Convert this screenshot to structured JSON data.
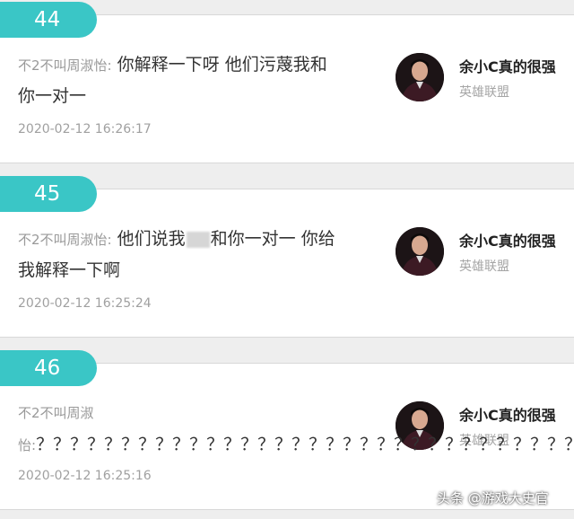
{
  "comments": [
    {
      "number": "44",
      "sender": "不2不叫周淑怡:",
      "text_line1": "你解释一下呀 他们污蔑我和",
      "text_line2": "你一对一",
      "timestamp": "2020-02-12 16:26:17",
      "recipient": "余小C真的很强",
      "game": "英雄联盟"
    },
    {
      "number": "45",
      "sender": "不2不叫周淑怡:",
      "text_before_blur": "他们说我",
      "text_after_blur": "和你一对一 你给",
      "text_line2": "我解释一下啊",
      "timestamp": "2020-02-12 16:25:24",
      "recipient": "余小C真的很强",
      "game": "英雄联盟"
    },
    {
      "number": "46",
      "sender_line1": "不2不叫周淑",
      "sender_line2": "怡:",
      "question_marks": "？？？？？？？？？？？？？？？？？？？？？？？？？？？？？？？？",
      "timestamp": "2020-02-12 16:25:16",
      "recipient": "余小C真的很强",
      "game": "英雄联盟"
    }
  ],
  "watermark": "头条 @游戏大史官",
  "colors": {
    "badge": "#3ac6c6",
    "timestamp": "#a0a0a0",
    "game": "#a5a5a5"
  }
}
